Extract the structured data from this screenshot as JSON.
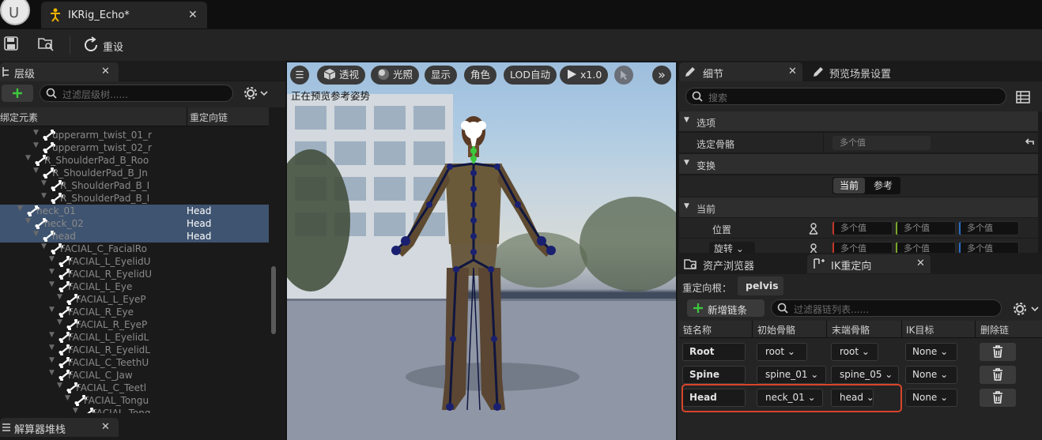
{
  "window": {
    "tab_title": "IKRig_Echo*"
  },
  "toolbar": {
    "reset_label": "重设"
  },
  "hierarchy": {
    "tab_label": "层级",
    "search_placeholder": "过滤层级树......",
    "col_bind": "绑定元素",
    "col_chain": "重定向链",
    "rows": [
      {
        "name": "upperarm_twist_01_r",
        "chain": "",
        "indent": 5,
        "sel": false
      },
      {
        "name": "upperarm_twist_02_r",
        "chain": "",
        "indent": 5,
        "sel": false
      },
      {
        "name": "R_ShoulderPad_B_Roo",
        "chain": "",
        "indent": 4,
        "sel": false
      },
      {
        "name": "R_ShoulderPad_B_Jn",
        "chain": "",
        "indent": 5,
        "sel": false
      },
      {
        "name": "R_ShoulderPad_B_I",
        "chain": "",
        "indent": 6,
        "sel": false
      },
      {
        "name": "R_ShoulderPad_B_I",
        "chain": "",
        "indent": 6,
        "sel": false
      },
      {
        "name": "neck_01",
        "chain": "Head",
        "indent": 3,
        "sel": true
      },
      {
        "name": "neck_02",
        "chain": "Head",
        "indent": 4,
        "sel": true
      },
      {
        "name": "head",
        "chain": "Head",
        "indent": 5,
        "sel": true
      },
      {
        "name": "FACIAL_C_FacialRo",
        "chain": "",
        "indent": 6,
        "sel": false
      },
      {
        "name": "FACIAL_L_EyelidU",
        "chain": "",
        "indent": 7,
        "sel": false
      },
      {
        "name": "FACIAL_R_EyelidU",
        "chain": "",
        "indent": 7,
        "sel": false
      },
      {
        "name": "FACIAL_L_Eye",
        "chain": "",
        "indent": 7,
        "sel": false
      },
      {
        "name": "FACIAL_L_EyeP",
        "chain": "",
        "indent": 8,
        "sel": false
      },
      {
        "name": "FACIAL_R_Eye",
        "chain": "",
        "indent": 7,
        "sel": false
      },
      {
        "name": "FACIAL_R_EyeP",
        "chain": "",
        "indent": 8,
        "sel": false
      },
      {
        "name": "FACIAL_L_EyelidL",
        "chain": "",
        "indent": 7,
        "sel": false
      },
      {
        "name": "FACIAL_R_EyelidL",
        "chain": "",
        "indent": 7,
        "sel": false
      },
      {
        "name": "FACIAL_C_TeethU",
        "chain": "",
        "indent": 7,
        "sel": false
      },
      {
        "name": "FACIAL_C_Jaw",
        "chain": "",
        "indent": 7,
        "sel": false
      },
      {
        "name": "FACIAL_C_Teetl",
        "chain": "",
        "indent": 8,
        "sel": false
      },
      {
        "name": "FACIAL_Tongu",
        "chain": "",
        "indent": 9,
        "sel": false
      },
      {
        "name": "FACIAL_Tong",
        "chain": "",
        "indent": 10,
        "sel": false
      }
    ]
  },
  "solver": {
    "tab_label": "解算器堆栈"
  },
  "viewport": {
    "btn_menu": "☰",
    "btn_perspective": "透视",
    "btn_lit": "光照",
    "btn_show": "显示",
    "btn_character": "角色",
    "btn_lod": "LOD自动",
    "btn_play": "x1.0",
    "btn_more": "»",
    "overlay_text": "正在预览参考姿势"
  },
  "details": {
    "tab_label": "细节",
    "tab2_label": "预览场景设置",
    "search_placeholder": "搜索",
    "section_options": "选项",
    "selected_bones_label": "选定骨骼",
    "selected_bones_value": "多个值",
    "section_transform": "变换",
    "toggle_current": "当前",
    "toggle_reference": "参考",
    "section_current": "当前",
    "position_label": "位置",
    "multi": "多个值",
    "rotation_label": "旋转"
  },
  "ikretarget": {
    "tab_asset": "资产浏览器",
    "tab_ik": "IK重定向",
    "root_label": "重定向根：",
    "root_value": "pelvis",
    "add_chain": "新增链条",
    "search_placeholder": "过滤器链列表......",
    "col_name": "链名称",
    "col_start": "初始骨骼",
    "col_end": "末端骨骼",
    "col_goal": "IK目标",
    "col_delete": "删除链",
    "chains": [
      {
        "name": "Root",
        "start": "root",
        "end": "root",
        "goal": "None"
      },
      {
        "name": "Spine",
        "start": "spine_01",
        "end": "spine_05",
        "goal": "None"
      },
      {
        "name": "Head",
        "start": "neck_01",
        "end": "head",
        "goal": "None"
      }
    ],
    "highlight_color": "#d9452b"
  },
  "colors": {
    "selection": "#3f5470",
    "accent_green": "#3cc93c"
  }
}
